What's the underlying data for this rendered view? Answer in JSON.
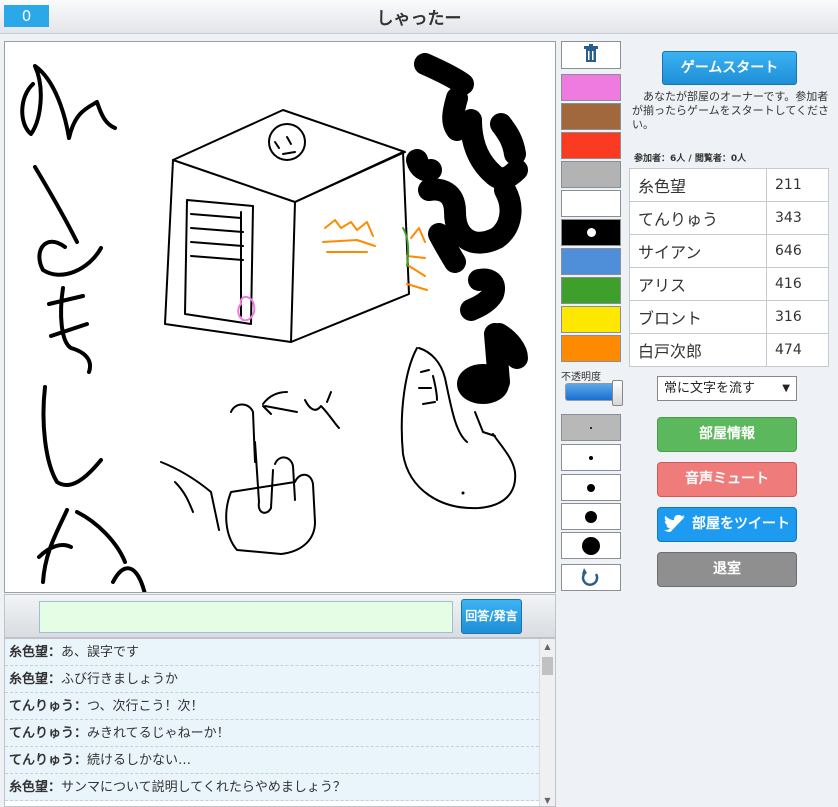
{
  "header": {
    "counter": "0",
    "title": "しゃったー"
  },
  "palette": {
    "colors": [
      "#f07be0",
      "#a0683c",
      "#fb3b21",
      "#b3b3b3",
      "#ffffff",
      "#000000",
      "#4f8fd9",
      "#3ea02b",
      "#ffe800",
      "#fd8a00"
    ],
    "opacity_label": "不透明度",
    "opacity": 1.0
  },
  "right": {
    "start_button": "ゲームスタート",
    "owner_note": "あなたが部屋のオーナーです。参加者が揃ったらゲームをスタートしてください。",
    "participants_label": "参加者：6人",
    "viewers_label": "閲覧者：0人",
    "separator": "/",
    "players": [
      {
        "name": "糸色望",
        "score": "211"
      },
      {
        "name": "てんりゅう",
        "score": "343"
      },
      {
        "name": "サイアン",
        "score": "646"
      },
      {
        "name": "アリス",
        "score": "416"
      },
      {
        "name": "ブロント",
        "score": "316"
      },
      {
        "name": "白戸次郎",
        "score": "474"
      }
    ],
    "scroll_option": "常に文字を流す",
    "info_button": "部屋情報",
    "mute_button": "音声ミュート",
    "tweet_button": "部屋をツイート",
    "leave_button": "退室"
  },
  "input": {
    "value": "",
    "button": "回答/発言"
  },
  "chat": [
    {
      "name": "糸色望",
      "text": "あ、誤字です"
    },
    {
      "name": "糸色望",
      "text": "ふび行きましょうか"
    },
    {
      "name": "てんりゅう",
      "text": "つ、次行こう！次！"
    },
    {
      "name": "てんりゅう",
      "text": "みきれてるじゃねーか！"
    },
    {
      "name": "てんりゅう",
      "text": "続けるしかない…"
    },
    {
      "name": "糸色望",
      "text": "サンマについて説明してくれたらやめましょう？"
    }
  ]
}
